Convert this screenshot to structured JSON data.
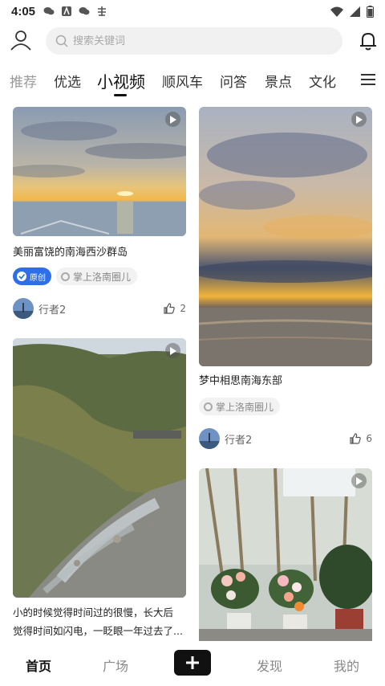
{
  "status_bar": {
    "time": "4:05"
  },
  "search": {
    "placeholder": "搜索关键词"
  },
  "tabs": [
    "推荐",
    "优选",
    "小视频",
    "顺风车",
    "问答",
    "景点",
    "文化"
  ],
  "cards": [
    {
      "title": "美丽富饶的南海西沙群岛",
      "original_tag": "原创",
      "circle_tag": "掌上洛南圈儿",
      "author": "行者2",
      "likes": "2"
    },
    {
      "title": "梦中相思南海东部",
      "circle_tag": "掌上洛南圈儿",
      "author": "行者2",
      "likes": "6"
    },
    {
      "title_line1": "小的时候觉得时间过的很慢，长大后",
      "title_line2": "觉得时间如闪电，一眨眼一年过去了..."
    }
  ],
  "bottom_nav": {
    "home": "首页",
    "square": "广场",
    "discover": "发现",
    "mine": "我的"
  }
}
